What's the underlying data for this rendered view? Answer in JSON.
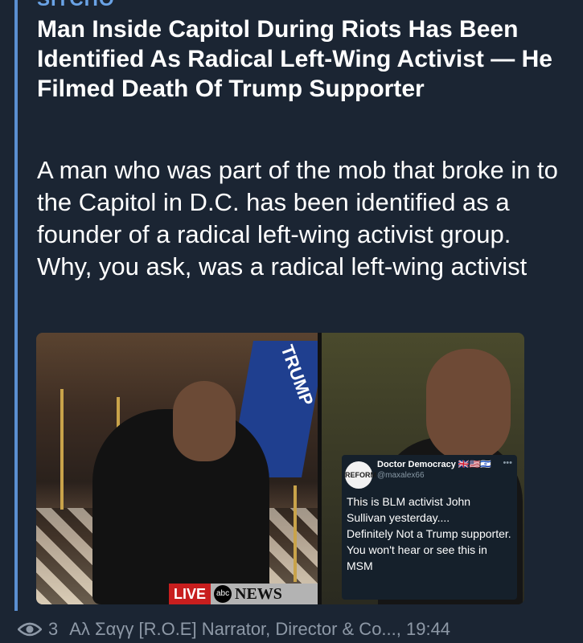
{
  "message": {
    "site_name": "SITCHO",
    "title": "Man Inside Capitol During Riots Has Been Identified As Radical Left-Wing Activist — He Filmed Death Of Trump Supporter",
    "description": "A man who was part of the mob that broke in to the Capitol in D.C. has been identified as a founder of a radical left-wing activist group.    Why, you ask, was a radical left-wing activist"
  },
  "preview": {
    "left_image": {
      "flag_text": "TRUMP",
      "live_label": "LIVE",
      "network_logo": "abc",
      "news_label": "NEWS"
    },
    "tweet": {
      "avatar_text": "REFORM UK",
      "name": "Doctor Democracy",
      "flags": "🇬🇧🇺🇸🇮🇱",
      "handle": "@maxalex66",
      "more": "•••",
      "body": "This is BLM activist John Sullivan yesterday....\nDefinitely Not a Trump supporter.\nYou won't hear or see this in MSM"
    }
  },
  "footer": {
    "views_icon": "eye-icon",
    "views": "3",
    "author_time": "Αλ Σαγγ [R.O.E] Narrator, Director & Co..., 19:44"
  },
  "colors": {
    "background": "#1b2533",
    "accent": "#5a8fd1",
    "text": "#ffffff",
    "meta_text": "#8e99a7"
  }
}
